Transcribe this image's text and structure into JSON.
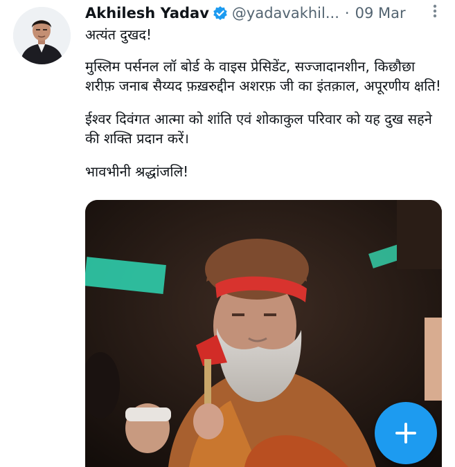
{
  "tweet": {
    "author_name": "Akhilesh Yadav",
    "handle": "@yadavakhil...",
    "separator": "·",
    "date": "09 Mar",
    "paragraphs": [
      "अत्यंत दुखद!",
      "मुस्लिम पर्सनल लॉ बोर्ड के वाइस प्रेसिडेंट, सज्जादानशीन, किछौछा शरीफ़ जनाब सैय्यद फ़ख़रुद्दीन अशरफ़ जी का इंतक़ाल, अपूरणीय क्षति!",
      "ईश्वर दिवंगत आत्मा को शांति एवं शोकाकुल परिवार को यह दुख सहने की शक्ति प्रदान करें।",
      "भावभीनी श्रद्धांजलि!"
    ]
  },
  "icons": {
    "verified": "verified-badge-icon",
    "more": "more-options-icon",
    "compose": "plus-icon"
  },
  "colors": {
    "accent": "#1d9bf0",
    "text_primary": "#0f1419",
    "text_secondary": "#536471"
  }
}
